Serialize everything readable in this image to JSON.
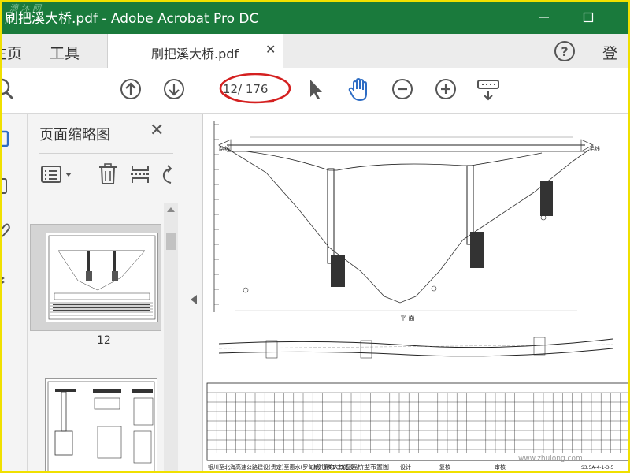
{
  "window": {
    "title": "刷把溪大桥.pdf - Adobe Acrobat Pro DC",
    "watermark": "滴 沐 网"
  },
  "tabs": {
    "home": "主页",
    "tools": "工具",
    "document": "刷把溪大桥.pdf",
    "signin": "登录"
  },
  "toolbar": {
    "current_page": "12",
    "total_pages": "/ 176"
  },
  "panel": {
    "title": "页面缩略图",
    "thumbnail_label": "12"
  },
  "document": {
    "plan_label": "平  面",
    "title_block": {
      "project": "银川至北海高速公路建设(贵定)至惠水(罗甸)段 第T1-二施设",
      "drawing_title": "刷把溪大桥左幅桥型布置图",
      "design": "设计",
      "check": "复核",
      "review": "审核",
      "drawing_no": "图号",
      "drawing_no_value": "S3.5A-4-1-3-5"
    },
    "left_label": "路线",
    "right_label": "毛线",
    "watermark": "www.zhulong.com"
  },
  "colors": {
    "titlebar": "#1a7a3c",
    "accent_blue": "#2d6cc4",
    "annotation_red": "#d42020",
    "frame_yellow": "#f0e000"
  }
}
